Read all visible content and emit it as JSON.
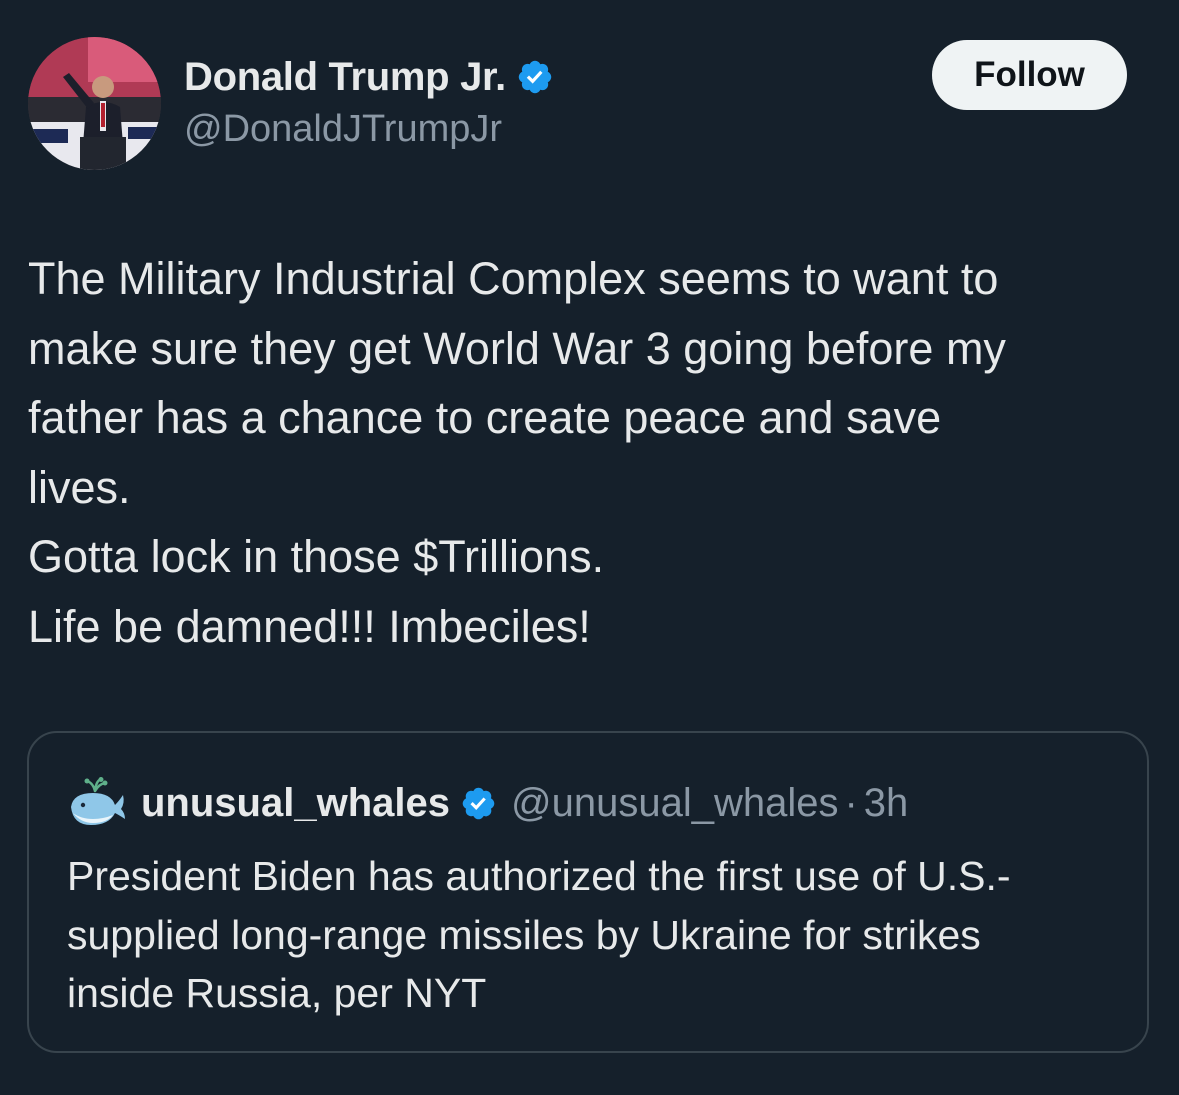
{
  "author": {
    "display_name": "Donald Trump Jr.",
    "handle": "@DonaldJTrumpJr",
    "verified": true
  },
  "follow_button": {
    "label": "Follow"
  },
  "tweet": {
    "text_lines": [
      "The Military Industrial Complex seems to want to",
      "make sure they get World War 3 going before my",
      "father has a chance to create peace and save",
      "lives.",
      "Gotta lock in those $Trillions.",
      "Life be damned!!! Imbeciles!"
    ]
  },
  "quoted_tweet": {
    "display_name": "unusual_whales",
    "handle": "@unusual_whales",
    "separator": "·",
    "time": "3h",
    "verified": true,
    "text_lines": [
      "President Biden has authorized the first use of U.S.-",
      "supplied long-range missiles by Ukraine for strikes",
      "inside Russia, per NYT"
    ]
  },
  "icons": {
    "verified": "verified-badge-icon",
    "quote_avatar": "whale-icon"
  },
  "colors": {
    "background": "#15202b",
    "primary_text": "#e7e9ea",
    "secondary_text": "#8b98a5",
    "verified_blue": "#1d9bf0",
    "follow_button_bg": "#eff3f4",
    "follow_button_text": "#0f1419",
    "card_border": "#38444d"
  }
}
